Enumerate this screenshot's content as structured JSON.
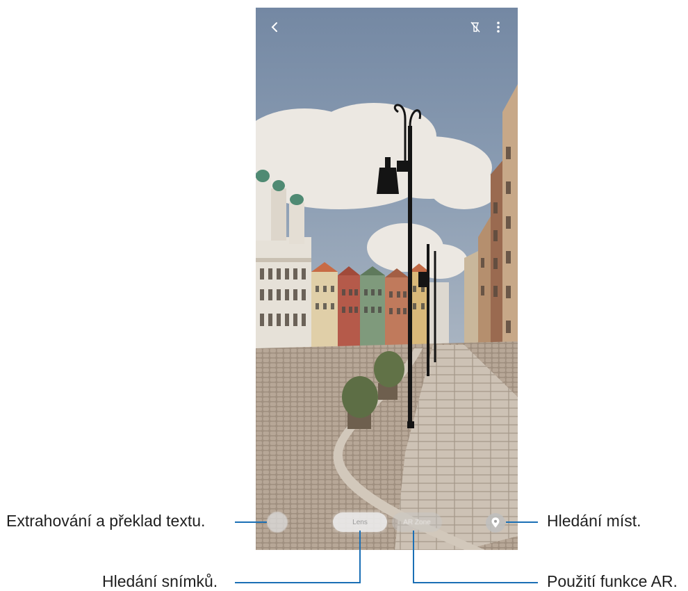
{
  "screen": {
    "mode_labels": {
      "lens": "Lens",
      "ar": "AR Zone"
    },
    "icons": {
      "back": "chevron-left-icon",
      "flashlight": "flashlight-off-icon",
      "more": "more-vertical-icon",
      "text": "text-extract-icon",
      "place": "location-pin-icon"
    }
  },
  "callouts": {
    "text_extract": "Extrahování a překlad textu.",
    "place_search": "Hledání míst.",
    "image_search": "Hledání snímků.",
    "ar_function": "Použití funkce AR."
  },
  "colors": {
    "leader_line": "#1a6fb5",
    "sky": "#8296ad",
    "cloud": "#ebe7e1",
    "pavement": "#a8998a"
  }
}
